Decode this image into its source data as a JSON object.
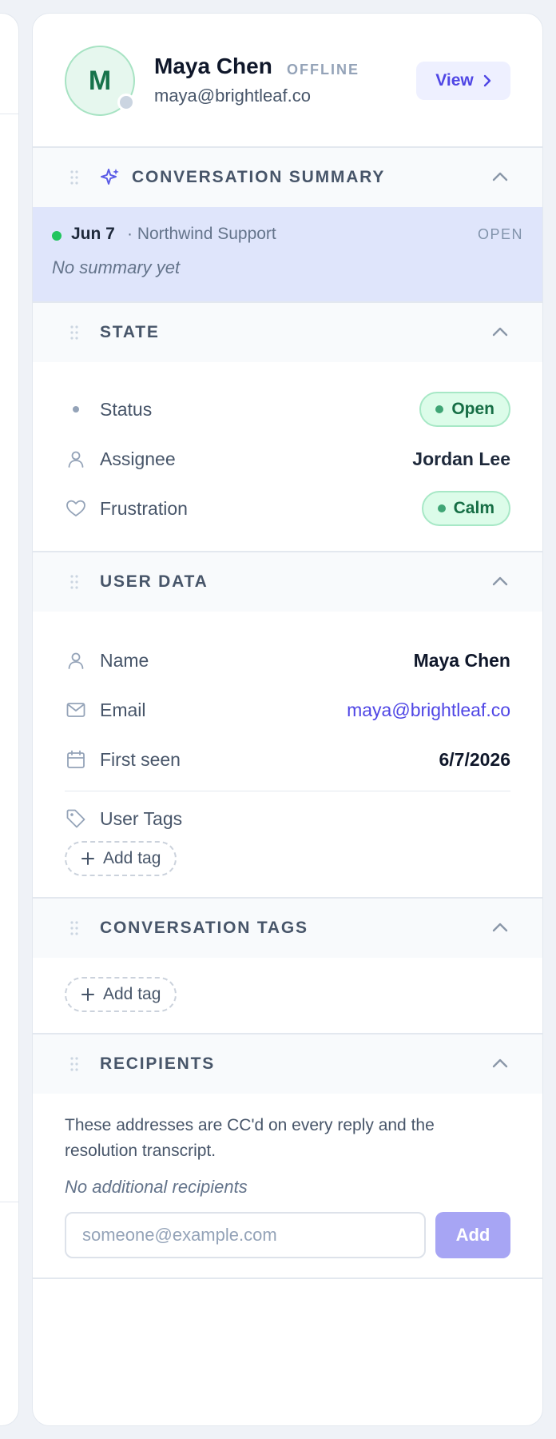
{
  "profile": {
    "initial": "M",
    "name": "Maya Chen",
    "status": "OFFLINE",
    "email": "maya@brightleaf.co",
    "view_label": "View"
  },
  "summary": {
    "title": "CONVERSATION SUMMARY",
    "date": "Jun 7",
    "source": "· Northwind Support",
    "state": "OPEN",
    "text": "No summary yet"
  },
  "state": {
    "title": "STATE",
    "rows": [
      {
        "label": "Status",
        "value": "Open"
      },
      {
        "label": "Assignee",
        "value": "Jordan Lee"
      },
      {
        "label": "Frustration",
        "value": "Calm"
      }
    ]
  },
  "user_data": {
    "title": "USER DATA",
    "rows": [
      {
        "label": "Name",
        "value": "Maya Chen"
      },
      {
        "label": "Email",
        "value": "maya@brightleaf.co"
      },
      {
        "label": "First seen",
        "value": "6/7/2026"
      }
    ],
    "tags_label": "User Tags",
    "add_tag_label": "Add tag"
  },
  "conversation_tags": {
    "title": "CONVERSATION TAGS",
    "add_tag_label": "Add tag"
  },
  "recipients": {
    "title": "RECIPIENTS",
    "description": "These addresses are CC'd on every reply and the resolution transcript.",
    "empty_text": "No additional recipients",
    "input_placeholder": "someone@example.com",
    "add_label": "Add"
  },
  "colors": {
    "accent": "#4f46e5",
    "success": "#166e45",
    "summary_bg": "#dfe5fb"
  }
}
